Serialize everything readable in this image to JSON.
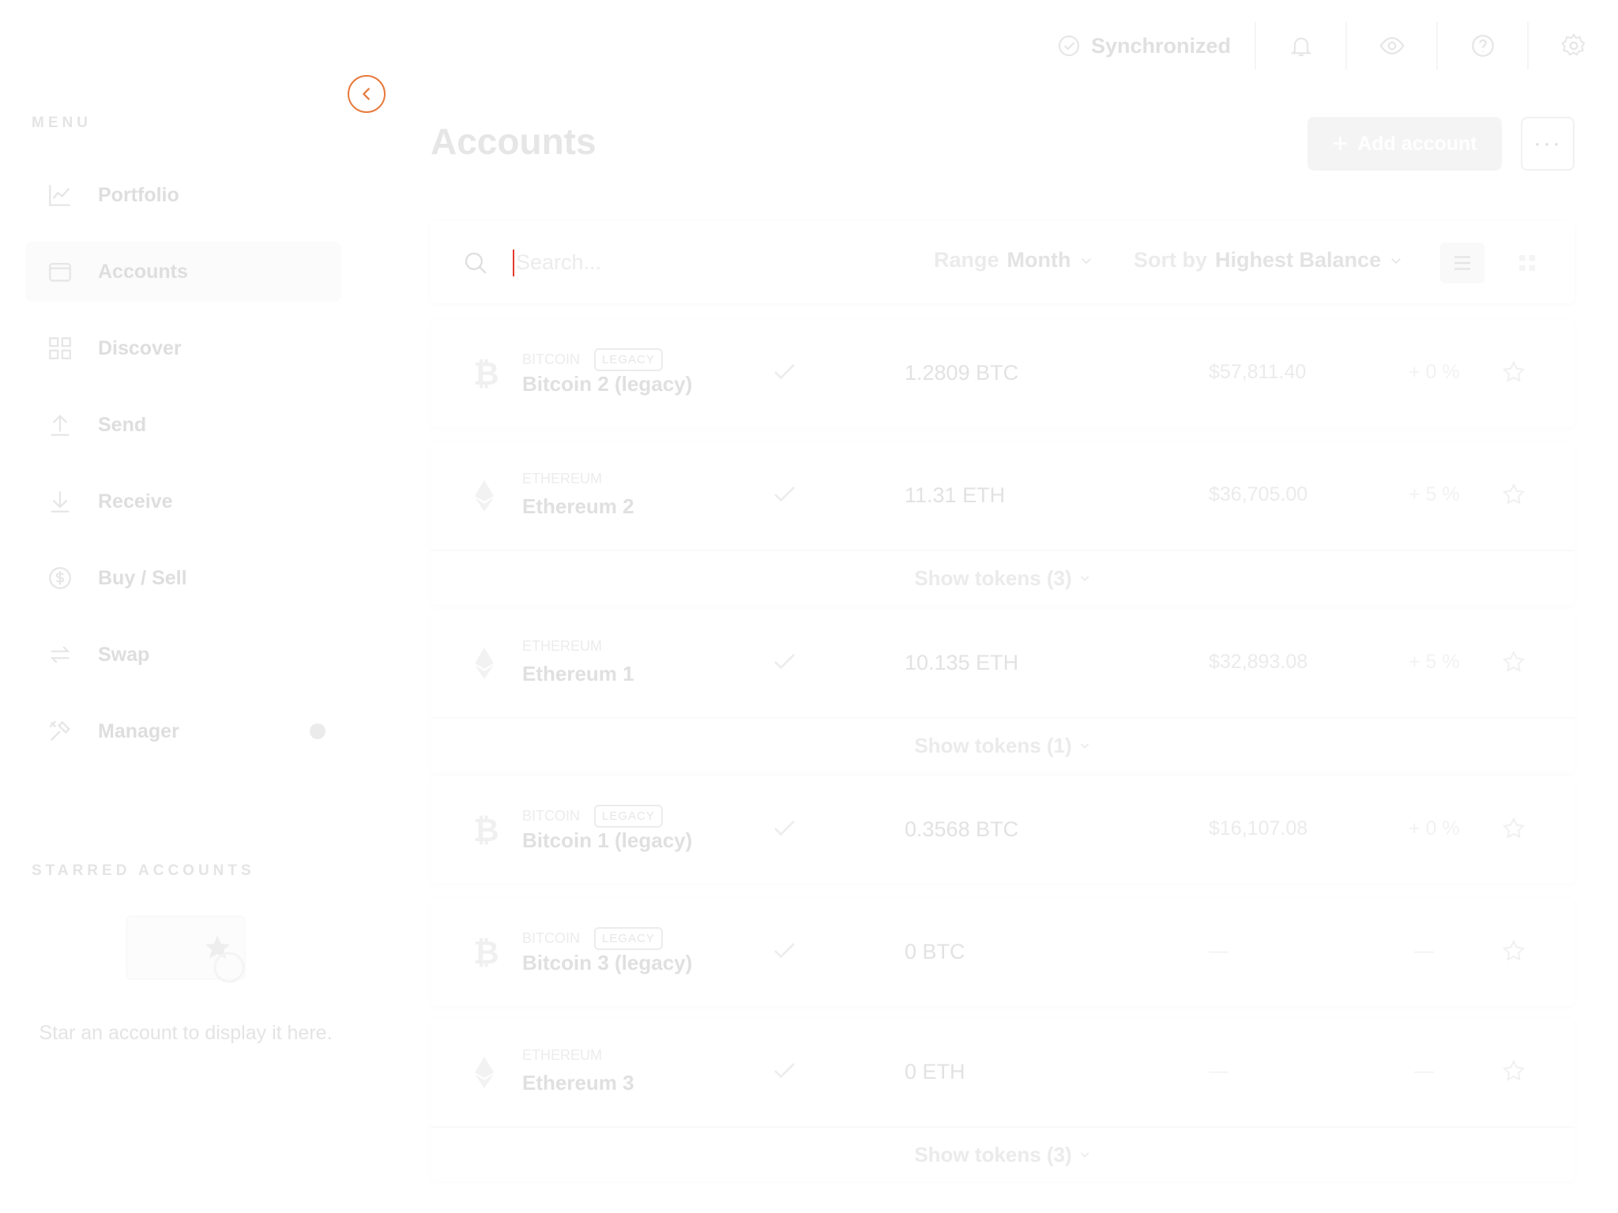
{
  "sidebar": {
    "menu_title": "MENU",
    "items": [
      {
        "label": "Portfolio",
        "icon": "chart-line-icon"
      },
      {
        "label": "Accounts",
        "icon": "wallet-icon",
        "active": true
      },
      {
        "label": "Discover",
        "icon": "grid-icon"
      },
      {
        "label": "Send",
        "icon": "arrow-up-icon"
      },
      {
        "label": "Receive",
        "icon": "arrow-down-icon"
      },
      {
        "label": "Buy / Sell",
        "icon": "dollar-icon"
      },
      {
        "label": "Swap",
        "icon": "swap-icon"
      },
      {
        "label": "Manager",
        "icon": "tools-icon"
      }
    ],
    "starred_title": "STARRED ACCOUNTS",
    "starred_empty": "Star an account to display it here."
  },
  "topbar": {
    "sync_label": "Synchronized"
  },
  "main": {
    "title": "Accounts",
    "add_account": "Add account",
    "more": "···",
    "search_placeholder": "Search...",
    "range_label": "Range",
    "range_value": "Month",
    "sort_label": "Sort by",
    "sort_value": "Highest Balance"
  },
  "accounts": [
    {
      "currency": "BITCOIN",
      "legacy": "LEGACY",
      "name": "Bitcoin 2 (legacy)",
      "balance": "1.2809 BTC",
      "fiat": "$57,811.40",
      "change": "+ 0 %"
    },
    {
      "currency": "ETHEREUM",
      "name": "Ethereum 2",
      "balance": "11.31 ETH",
      "fiat": "$36,705.00",
      "change": "+ 5 %",
      "tokens": "Show tokens (3)"
    },
    {
      "currency": "ETHEREUM",
      "name": "Ethereum 1",
      "balance": "10.135 ETH",
      "fiat": "$32,893.08",
      "change": "+ 5 %",
      "tokens": "Show tokens (1)"
    },
    {
      "currency": "BITCOIN",
      "legacy": "LEGACY",
      "name": "Bitcoin 1 (legacy)",
      "balance": "0.3568 BTC",
      "fiat": "$16,107.08",
      "change": "+ 0 %"
    },
    {
      "currency": "BITCOIN",
      "legacy": "LEGACY",
      "name": "Bitcoin 3 (legacy)",
      "balance": "0 BTC",
      "fiat": "—",
      "change": "—"
    },
    {
      "currency": "ETHEREUM",
      "name": "Ethereum 3",
      "balance": "0 ETH",
      "fiat": "—",
      "change": "—",
      "tokens": "Show tokens (3)"
    }
  ],
  "colors": {
    "accent": "#e8793b",
    "caret": "#e33b2e"
  }
}
